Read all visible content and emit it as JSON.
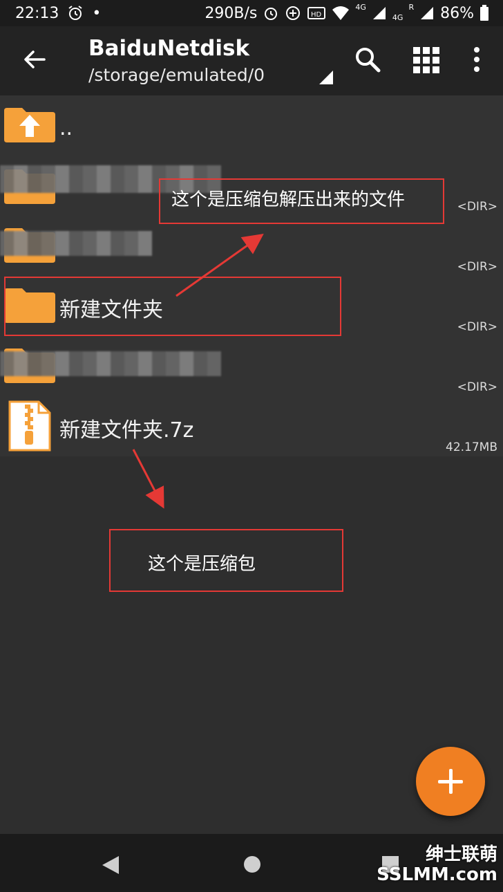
{
  "status_bar": {
    "time": "22:13",
    "dot": "•",
    "net_speed": "290B/s",
    "sig1": "4G",
    "sig2": "4G",
    "roaming": "R",
    "battery": "86%"
  },
  "toolbar": {
    "title": "BaiduNetdisk",
    "path": "/storage/emulated/0"
  },
  "files": [
    {
      "name": "..",
      "meta": ""
    },
    {
      "name": "",
      "meta": "<DIR>"
    },
    {
      "name": "",
      "meta": "<DIR>"
    },
    {
      "name": "新建文件夹",
      "meta": "<DIR>"
    },
    {
      "name": "",
      "meta": "<DIR>"
    },
    {
      "name": "新建文件夹.7z",
      "meta": "42.17MB"
    }
  ],
  "annotations": {
    "extracted": "这个是压缩包解压出来的文件",
    "archive": "这个是压缩包"
  },
  "watermark": {
    "line1": "绅士联萌",
    "line2": "SSLMM.com"
  },
  "colors": {
    "accent": "#f07f22",
    "folder": "#f5a13a",
    "annotation": "#e53935"
  }
}
